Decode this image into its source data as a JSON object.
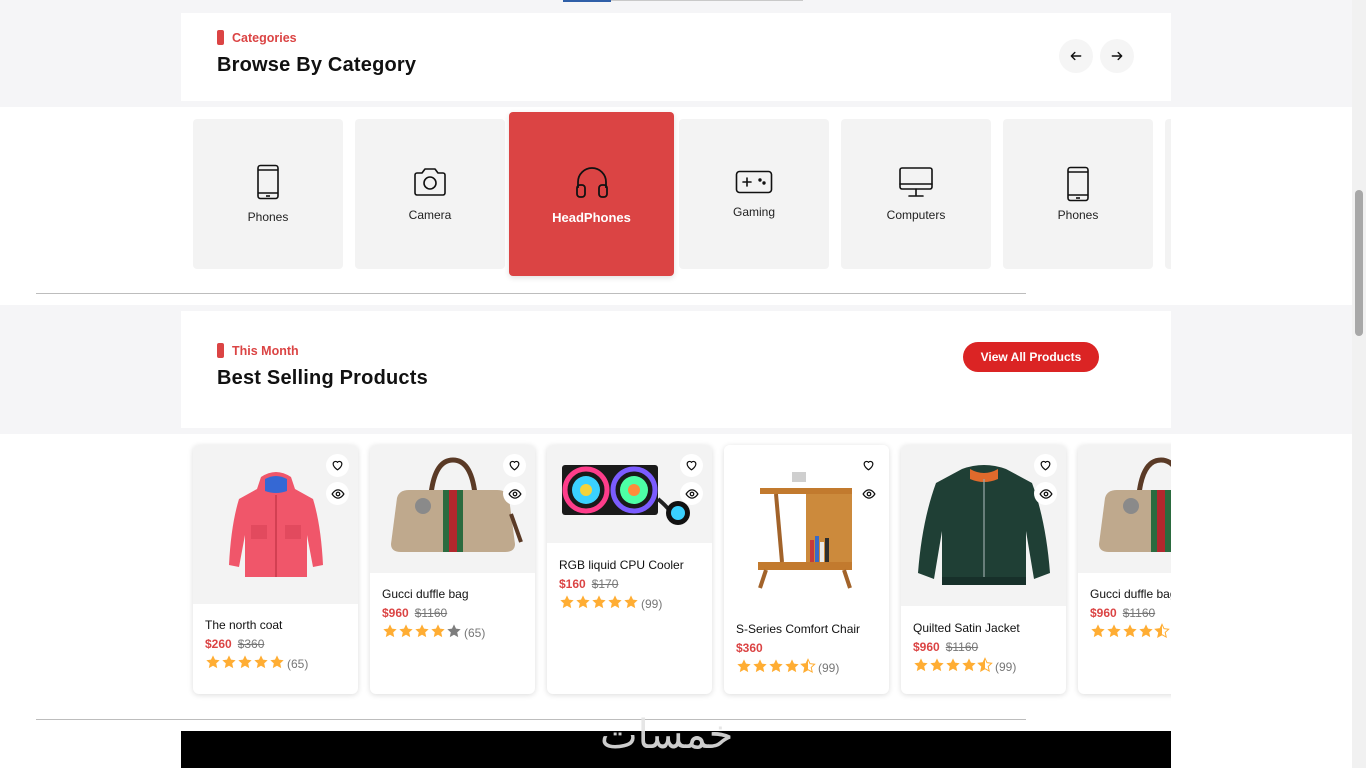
{
  "categories_section": {
    "eyebrow": "Categories",
    "title": "Browse By Category",
    "items": [
      {
        "label": "Phones",
        "icon": "phone-icon",
        "active": false
      },
      {
        "label": "Camera",
        "icon": "camera-icon",
        "active": false
      },
      {
        "label": "HeadPhones",
        "icon": "headphones-icon",
        "active": true
      },
      {
        "label": "Gaming",
        "icon": "gamepad-icon",
        "active": false
      },
      {
        "label": "Computers",
        "icon": "computer-icon",
        "active": false
      },
      {
        "label": "Phones",
        "icon": "phone-icon",
        "active": false
      }
    ]
  },
  "best_selling": {
    "eyebrow": "This Month",
    "title": "Best Selling Products",
    "view_all_label": "View All Products",
    "products": [
      {
        "name": "The north coat",
        "price": "$260",
        "old_price": "$360",
        "rating": 5,
        "reviews": "(65)"
      },
      {
        "name": "Gucci duffle bag",
        "price": "$960",
        "old_price": "$1160",
        "rating": 4,
        "reviews": "(65)"
      },
      {
        "name": "RGB liquid CPU Cooler",
        "price": "$160",
        "old_price": "$170",
        "rating": 5,
        "reviews": "(99)"
      },
      {
        "name": "S-Series Comfort Chair",
        "price": "$360",
        "old_price": "",
        "rating": 4.5,
        "reviews": "(99)"
      },
      {
        "name": "Quilted Satin Jacket",
        "price": "$960",
        "old_price": "$1160",
        "rating": 4.5,
        "reviews": "(99)"
      },
      {
        "name": "Gucci duffle bag",
        "price": "$960",
        "old_price": "$1160",
        "rating": 4.5,
        "reviews": ""
      }
    ]
  },
  "colors": {
    "accent": "#db4444",
    "button": "#db2424",
    "star": "#ffad33"
  },
  "watermark": "خمسات"
}
